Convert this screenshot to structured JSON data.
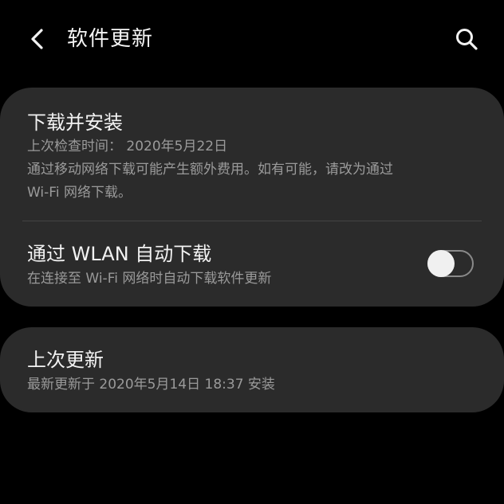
{
  "header": {
    "title": "软件更新",
    "back_icon": "back-arrow-icon",
    "search_icon": "search-icon"
  },
  "download_install": {
    "title": "下载并安装",
    "last_checked": "上次检查时间： 2020年5月22日",
    "note_line1": "通过移动网络下载可能产生额外费用。如有可能，请改为通过",
    "note_line2": "Wi-Fi 网络下载。"
  },
  "auto_download": {
    "title": "通过 WLAN 自动下载",
    "description": "在连接至 Wi-Fi 网络时自动下载软件更新",
    "toggle_on": false
  },
  "last_update": {
    "title": "上次更新",
    "description": "最新更新于 2020年5月14日 18:37 安装"
  },
  "colors": {
    "background": "#000000",
    "card": "#2b2b2b",
    "primary_text": "#f2f2f2",
    "secondary_text": "#9a9a9a"
  }
}
